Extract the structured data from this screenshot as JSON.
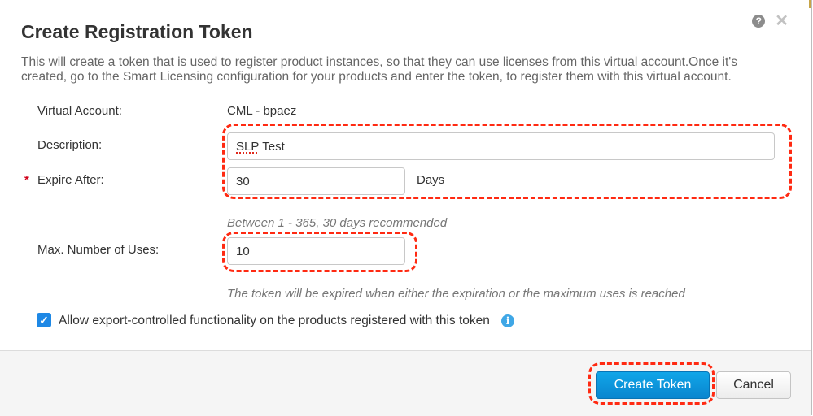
{
  "dialog": {
    "title": "Create Registration Token",
    "help_icon": "question-circle-icon",
    "close_icon": "close-x-icon",
    "intro_text": "This will create a token that is used to register product instances, so that they can use licenses from this virtual account.Once it's created, go to the Smart Licensing configuration for your products and enter the token, to register them with this virtual account."
  },
  "form": {
    "virtual_account": {
      "label": "Virtual Account:",
      "value": "CML - bpaez"
    },
    "description": {
      "label": "Description:",
      "value": "SLP Test",
      "spell_flagged": "SLP",
      "rest": " Test"
    },
    "expire_after": {
      "required_marker": "*",
      "label": "Expire After:",
      "value": "30",
      "unit": "Days",
      "hint": "Between 1 - 365, 30 days recommended"
    },
    "max_uses": {
      "label": "Max. Number of Uses:",
      "value": "10",
      "hint": "The token will be expired when either the expiration or the maximum uses is reached"
    },
    "export_controlled": {
      "checked": true,
      "label": "Allow export-controlled functionality on the products registered with this token",
      "info_icon": "info-circle-icon"
    }
  },
  "footer": {
    "create_label": "Create Token",
    "cancel_label": "Cancel"
  },
  "colors": {
    "primary_button": "#0a96dc",
    "annotation_highlight": "#ff2a12",
    "checkbox": "#1e88e5",
    "required": "#d0021b"
  }
}
